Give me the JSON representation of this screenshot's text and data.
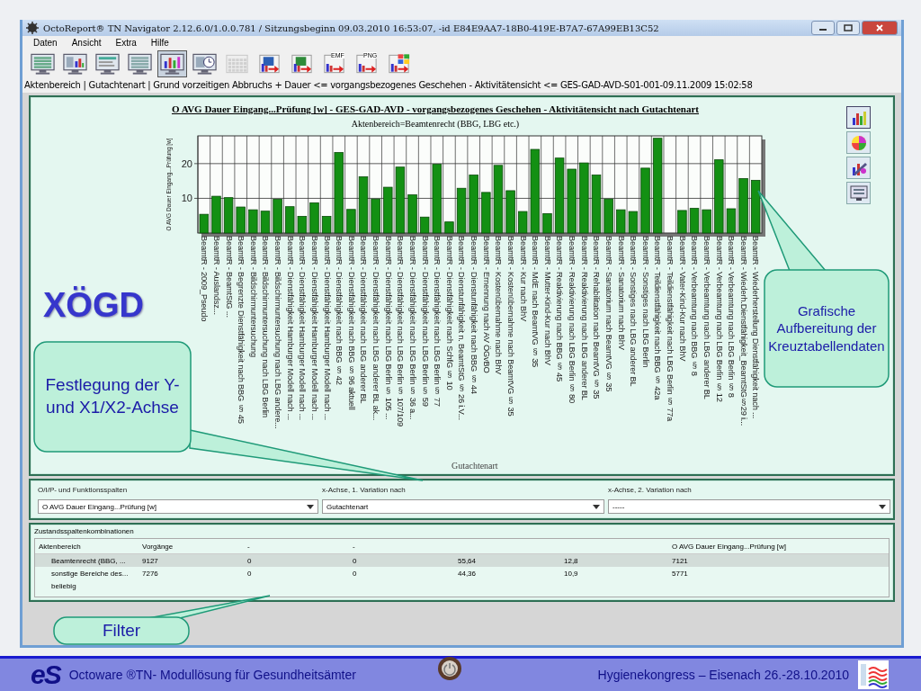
{
  "window": {
    "title": "OctoReport® TN Navigator 2.12.6.0/1.0.0.781 / Sitzungsbeginn 09.03.2010 16:53:07, -id E84E9AA7-18B0-419E-B7A7-67A99EB13C52"
  },
  "menu": [
    "Daten",
    "Ansicht",
    "Extra",
    "Hilfe"
  ],
  "toolbar": [
    {
      "kind": "table",
      "selected": false,
      "disabled": false
    },
    {
      "kind": "chart-table",
      "selected": false,
      "disabled": false
    },
    {
      "kind": "list",
      "selected": false,
      "disabled": false
    },
    {
      "kind": "grid",
      "selected": false,
      "disabled": false
    },
    {
      "kind": "bar-chart",
      "selected": true,
      "disabled": false
    },
    {
      "kind": "clock",
      "selected": false,
      "disabled": false
    },
    {
      "kind": "calendar",
      "selected": false,
      "disabled": true
    },
    {
      "kind": "word",
      "selected": false,
      "disabled": false
    },
    {
      "kind": "excel",
      "selected": false,
      "disabled": false
    },
    {
      "kind": "export",
      "label": "EMF",
      "selected": false,
      "disabled": false
    },
    {
      "kind": "export",
      "label": "PNG",
      "selected": false,
      "disabled": false
    },
    {
      "kind": "windows",
      "selected": false,
      "disabled": false
    }
  ],
  "breadcrumb": "Aktenbereich | Gutachtenart | Grund vorzeitigen Abbruchs + Dauer <= vorgangsbezogenes Geschehen - Aktivitätensicht <= GES-GAD-AVD-S01-001-09.11.2009 15:02:58",
  "chart": {
    "chart_data": {
      "type": "bar",
      "title": "O AVG Dauer Eingang...Prüfung [w] - GES-GAD-AVD - vorgangsbezogenes Geschehen - Aktivitätensicht nach Gutachtenart",
      "subtitle": "Aktenbereich=Beamtenrecht (BBG, LBG etc.)",
      "xlabel": "Gutachtenart",
      "ylabel": "O AVG Dauer Eingang...Prüfung [w]",
      "ylim": [
        0,
        28
      ],
      "yticks": [
        10,
        20
      ],
      "categories": [
        "BeamtR - 2009_Pseudo",
        "BeamtR - Auslandsz...",
        "BeamtR - BeamtStG ...",
        "BeamtR - Begrenzte Dienstfähigkeit nach BBG § 45",
        "BeamtR - Bildschirmuntersuchung",
        "BeamtR - Bildschirmuntersuchung nach LBG Berlin",
        "BeamtR - Bildschirmuntersuchung nach LBG andere...",
        "BeamtR - Dienstfähigkeit Hamburger Modell nach ...",
        "BeamtR - Dienstfähigkeit Hamburger Modell nach ...",
        "BeamtR - Dienstfähigkeit Hamburger Modell nach ...",
        "BeamtR - Dienstfähigkeit Hamburger Modell nach ...",
        "BeamtR - Dienstfähigkeit nach BBG § 42",
        "BeamtR - Dienstfähigkeit nach BBG § 96 aktuell",
        "BeamtR - Dienstfähigkeit nach LBG anderer BL",
        "BeamtR - Dienstfähigkeit nach LBG anderer BL ak...",
        "BeamtR - Dienstfähigkeit nach LBG Berlin § 105 ...",
        "BeamtR - Dienstfähigkeit nach LBG Berlin § 107/109",
        "BeamtR - Dienstfähigkeit nach LBG Berlin § 36 a...",
        "BeamtR - Dienstfähigkeit nach LBG Berlin § 59",
        "BeamtR - Dienstfähigkeit nach LBG Berlin § 77",
        "BeamtR - Dienstfähigkeit nach SchfG § 10",
        "BeamtR - Dienstunfähigkeit n. BeamtStG § 26 i.V...",
        "BeamtR - Dienstunfähigkeit nach BBG § 44",
        "BeamtR - Ernennung nach AV ÖGvBO",
        "BeamtR - Kostenübernahme nach BhV",
        "BeamtR - Kostenübernahme nach BeamtVG § 35",
        "BeamtR - Kur nach BhV",
        "BeamtR - MdE nach BeamtVG § 35",
        "BeamtR - Mutter-Kind-Kur nach BhV",
        "BeamtR - Reaktivierung nach BBG § 45",
        "BeamtR - Reaktivierung nach LBG Berlin § 80",
        "BeamtR - Reaktivierung nach LBG anderer BL",
        "BeamtR - Rehabilitation nach BeamtVG § 35",
        "BeamtR - Sanatorium nach BeamtVG § 35",
        "BeamtR - Sanatorium nach BhV",
        "BeamtR - Sonstiges nach LBG anderer BL",
        "BeamtR - Sonstiges nach LBG Berlin",
        "BeamtR - Teildienstfähigkeit nach BBG § 42a",
        "BeamtR - Teildienstfähigkeit nach LBG Berlin § 77a",
        "BeamtR - Vater-Kind-Kur nach BhV",
        "BeamtR - Verbeamtung nach BBG § 8",
        "BeamtR - Verbeamtung nach LBG anderer BL",
        "BeamtR - Verbeamtung nach LBG Berlin § 12",
        "BeamtR - Verbeamtung nach LBG Berlin § 8",
        "BeamtR - Wiederh.Dienstfähigkeit_BeamtStG§29 i...",
        "BeamtR - Wiederherstellung Dienstfähigkeit nach ..."
      ],
      "values": [
        5.4,
        10.6,
        10.2,
        7.5,
        6.7,
        6.3,
        9.7,
        7.6,
        4.8,
        8.7,
        4.8,
        23.2,
        6.8,
        16.2,
        9.8,
        13.2,
        19.0,
        11.0,
        4.6,
        19.8,
        3.2,
        12.9,
        16.7,
        11.7,
        19.5,
        12.2,
        6.2,
        24.1,
        5.6,
        21.6,
        18.4,
        20.2,
        16.7,
        9.8,
        6.7,
        6.2,
        18.7,
        27.3,
        null,
        6.5,
        7.1,
        6.7,
        21.1,
        7.0,
        15.7,
        15.2
      ]
    }
  },
  "logo_overlay": "XÖGD",
  "filters": [
    {
      "label": "O/I/P- und Funktionsspalten",
      "value": "O AVG Dauer Eingang...Prüfung [w]"
    },
    {
      "label": "x-Achse, 1. Variation nach",
      "value": "Gutachtenart"
    },
    {
      "label": "x-Achse, 2. Variation nach",
      "value": "-----"
    }
  ],
  "table": {
    "title": "Zustandsspaltenkombinationen",
    "columns": [
      "Aktenbereich",
      "Vorgänge",
      "-",
      "-",
      "",
      "",
      "O AVG Dauer Eingang...Prüfung [w]"
    ],
    "rows": [
      {
        "cells": [
          "Beamtenrecht (BBG, ...",
          "9127",
          "0",
          "0",
          "55,64",
          "12,8",
          "7121"
        ],
        "selected": true
      },
      {
        "cells": [
          "sonstige Bereiche des...",
          "7276",
          "0",
          "0",
          "44,36",
          "10,9",
          "5771"
        ],
        "selected": false
      },
      {
        "cells": [
          "beliebig"
        ],
        "selected": false
      }
    ]
  },
  "callouts": [
    {
      "text": "Festlegung der Y- und X1/X2-Achse"
    },
    {
      "text": "Filter"
    },
    {
      "text": "Grafische Aufbereitung der Kreuztabellendaten"
    }
  ],
  "footer": {
    "logo": "eS",
    "left": "Octoware ®TN- Modullösung für Gesundheitsämter",
    "right": "Hygienekongress – Eisenach   26.-28.10.2010"
  }
}
